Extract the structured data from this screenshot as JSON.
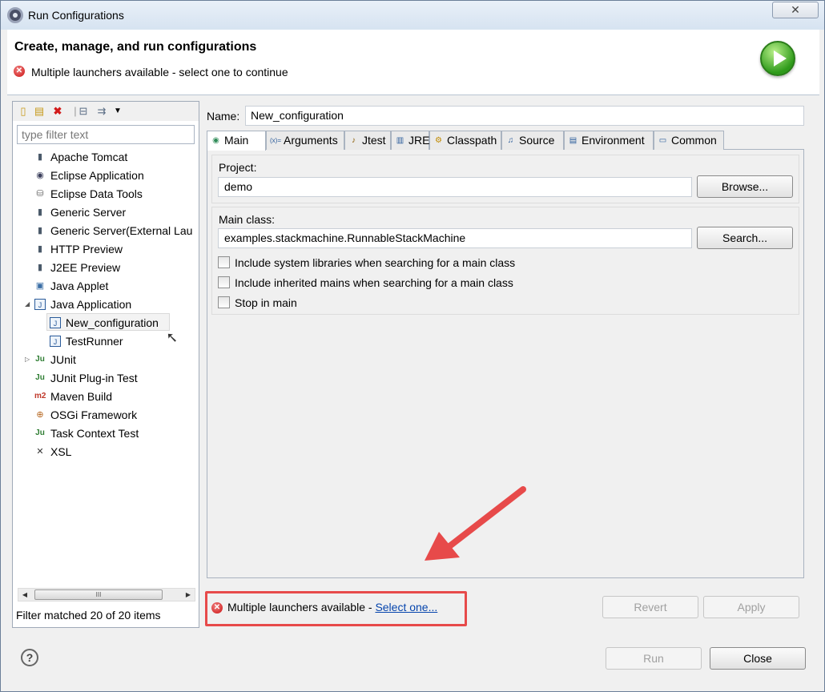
{
  "window": {
    "title": "Run Configurations",
    "close_glyph": "✕"
  },
  "header": {
    "title": "Create, manage, and run configurations",
    "message": "Multiple launchers available - select one to continue"
  },
  "left": {
    "filter_placeholder": "type filter text",
    "tree": [
      {
        "label": "Apache Tomcat",
        "icon": "server-icon",
        "glyph": "▮",
        "color": "#4b5a6a",
        "level": 0
      },
      {
        "label": "Eclipse Application",
        "icon": "eclipse-icon",
        "glyph": "◉",
        "color": "#3b3f5c",
        "level": 0
      },
      {
        "label": "Eclipse Data Tools",
        "icon": "database-icon",
        "glyph": "⛁",
        "color": "#666666",
        "level": 0
      },
      {
        "label": "Generic Server",
        "icon": "server-icon",
        "glyph": "▮",
        "color": "#4b5a6a",
        "level": 0
      },
      {
        "label": "Generic Server(External Lau",
        "icon": "server-icon",
        "glyph": "▮",
        "color": "#4b5a6a",
        "level": 0
      },
      {
        "label": "HTTP Preview",
        "icon": "server-icon",
        "glyph": "▮",
        "color": "#4b5a6a",
        "level": 0
      },
      {
        "label": "J2EE Preview",
        "icon": "server-icon",
        "glyph": "▮",
        "color": "#4b5a6a",
        "level": 0
      },
      {
        "label": "Java Applet",
        "icon": "applet-icon",
        "glyph": "▣",
        "color": "#3a6ea5",
        "level": 0
      },
      {
        "label": "Java Application",
        "icon": "java-app-icon",
        "glyph": "J",
        "color": "#2a5b9a",
        "level": 0,
        "expanded": true
      },
      {
        "label": "New_configuration",
        "icon": "java-app-icon",
        "glyph": "J",
        "color": "#2a5b9a",
        "level": 1,
        "selected": true
      },
      {
        "label": "TestRunner",
        "icon": "java-app-icon",
        "glyph": "J",
        "color": "#2a5b9a",
        "level": 1
      },
      {
        "label": "JUnit",
        "icon": "junit-icon",
        "glyph": "Ju",
        "color": "#2e7d32",
        "level": 0,
        "collapsed": true
      },
      {
        "label": "JUnit Plug-in Test",
        "icon": "junit-plugin-icon",
        "glyph": "Ju",
        "color": "#2e7d32",
        "level": 0
      },
      {
        "label": "Maven Build",
        "icon": "maven-icon",
        "glyph": "m2",
        "color": "#c0392b",
        "level": 0
      },
      {
        "label": "OSGi Framework",
        "icon": "osgi-icon",
        "glyph": "⊕",
        "color": "#b5651d",
        "level": 0
      },
      {
        "label": "Task Context Test",
        "icon": "task-icon",
        "glyph": "Ju",
        "color": "#2e7d32",
        "level": 0
      },
      {
        "label": "XSL",
        "icon": "xsl-icon",
        "glyph": "✕",
        "color": "#333333",
        "level": 0
      }
    ],
    "scroll_grip": "III",
    "status": "Filter matched 20 of 20 items"
  },
  "right": {
    "name_label": "Name:",
    "name_value": "New_configuration",
    "tabs": [
      {
        "label": "Main",
        "icon": "main-tab-icon",
        "glyph": "◉",
        "active": true
      },
      {
        "label": "Arguments",
        "icon": "arguments-icon",
        "glyph": "(x)="
      },
      {
        "label": "Jtest",
        "icon": "jtest-icon",
        "glyph": "♪"
      },
      {
        "label": "JRE",
        "icon": "jre-icon",
        "glyph": "▥"
      },
      {
        "label": "Classpath",
        "icon": "classpath-icon",
        "glyph": "⚙"
      },
      {
        "label": "Source",
        "icon": "source-icon",
        "glyph": "♫"
      },
      {
        "label": "Environment",
        "icon": "environment-icon",
        "glyph": "▤"
      },
      {
        "label": "Common",
        "icon": "common-icon",
        "glyph": "▭"
      }
    ],
    "project": {
      "label": "Project:",
      "value": "demo",
      "button": "Browse..."
    },
    "main_class": {
      "label": "Main class:",
      "value": "examples.stackmachine.RunnableStackMachine",
      "button": "Search..."
    },
    "checkboxes": [
      {
        "label": "Include system libraries when searching for a main class",
        "checked": false
      },
      {
        "label": "Include inherited mains when searching for a main class",
        "checked": false
      },
      {
        "label": "Stop in main",
        "checked": false
      }
    ],
    "bottom_message": "Multiple launchers available - ",
    "bottom_link": "Select one...",
    "revert": "Revert",
    "apply": "Apply"
  },
  "footer": {
    "help": "?",
    "run": "Run",
    "close": "Close"
  },
  "colors": {
    "annotation_red": "#e74a4a"
  }
}
